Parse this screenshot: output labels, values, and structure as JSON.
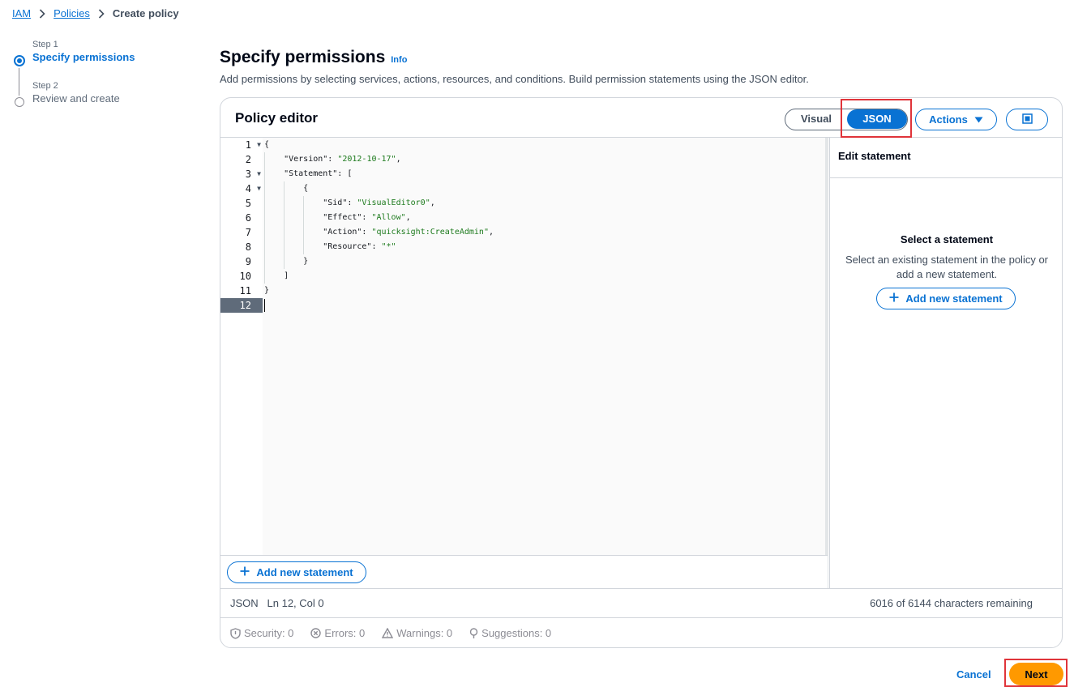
{
  "breadcrumb": {
    "items": [
      "IAM",
      "Policies"
    ],
    "current": "Create policy"
  },
  "steps": [
    {
      "num": "Step 1",
      "title": "Specify permissions"
    },
    {
      "num": "Step 2",
      "title": "Review and create"
    }
  ],
  "header": {
    "title": "Specify permissions",
    "info": "Info",
    "description": "Add permissions by selecting services, actions, resources, and conditions. Build permission statements using the JSON editor."
  },
  "editor": {
    "title": "Policy editor",
    "tabs": {
      "visual": "Visual",
      "json": "JSON"
    },
    "actions_label": "Actions",
    "line_numbers": [
      "1",
      "2",
      "3",
      "4",
      "5",
      "6",
      "7",
      "8",
      "9",
      "10",
      "11",
      "12"
    ],
    "code_lines": [
      "{",
      "    \"Version\": \"2012-10-17\",",
      "    \"Statement\": [",
      "        {",
      "            \"Sid\": \"VisualEditor0\",",
      "            \"Effect\": \"Allow\",",
      "            \"Action\": \"quicksight:CreateAdmin\",",
      "            \"Resource\": \"*\"",
      "        }",
      "    ]",
      "}",
      ""
    ],
    "add_statement_label": "Add new statement",
    "side": {
      "heading": "Edit statement",
      "empty_title": "Select a statement",
      "empty_desc_1": "Select an existing statement in the policy or",
      "empty_desc_2": "add a new statement.",
      "add_label": "Add new statement"
    },
    "status": {
      "mode": "JSON",
      "position": "Ln 12, Col 0",
      "remaining": "6016 of 6144 characters remaining"
    },
    "counts": {
      "security": "Security: 0",
      "errors": "Errors: 0",
      "warnings": "Warnings: 0",
      "suggestions": "Suggestions: 0"
    }
  },
  "footer": {
    "cancel": "Cancel",
    "next": "Next"
  },
  "colors": {
    "accent": "#0972d3",
    "primary": "#ff9900",
    "highlight": "#e0343a"
  }
}
